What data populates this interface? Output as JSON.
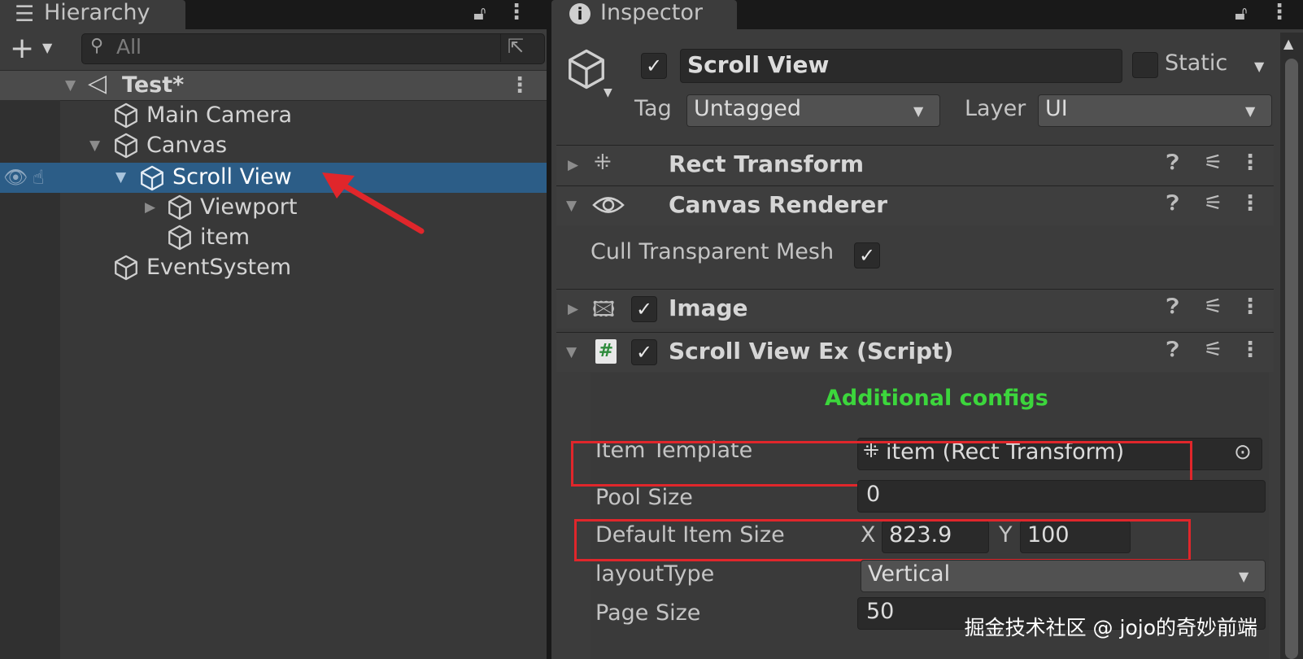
{
  "hierarchy": {
    "tab_title": "Hierarchy",
    "search_placeholder": "All",
    "scene_name": "Test*",
    "items": [
      {
        "label": "Main Camera"
      },
      {
        "label": "Canvas"
      },
      {
        "label": "Scroll View"
      },
      {
        "label": "Viewport"
      },
      {
        "label": "item"
      },
      {
        "label": "EventSystem"
      }
    ]
  },
  "inspector": {
    "tab_title": "Inspector",
    "object_name": "Scroll View",
    "static_label": "Static",
    "tag_label": "Tag",
    "tag_value": "Untagged",
    "layer_label": "Layer",
    "layer_value": "UI",
    "components": [
      {
        "title": "Rect Transform"
      },
      {
        "title": "Canvas Renderer"
      },
      {
        "title": "Image"
      },
      {
        "title": "Scroll View Ex (Script)"
      }
    ],
    "canvas_renderer": {
      "cull_label": "Cull Transparent Mesh"
    },
    "script": {
      "section_title": "Additional configs",
      "item_template_label": "Item Template",
      "item_template_value": "item (Rect Transform)",
      "pool_size_label": "Pool Size",
      "pool_size_value": "0",
      "default_item_size_label": "Default Item Size",
      "x_label": "X",
      "x_value": "823.9",
      "y_label": "Y",
      "y_value": "100",
      "layout_type_label": "layoutType",
      "layout_type_value": "Vertical",
      "page_size_label": "Page Size",
      "page_size_value": "50"
    }
  },
  "watermark": "掘金技术社区 @ jojo的奇妙前端",
  "colors": {
    "selection": "#2c5d87",
    "highlight_box": "#e0262b",
    "green_title": "#3cd63c",
    "arrow": "#e0262b"
  }
}
